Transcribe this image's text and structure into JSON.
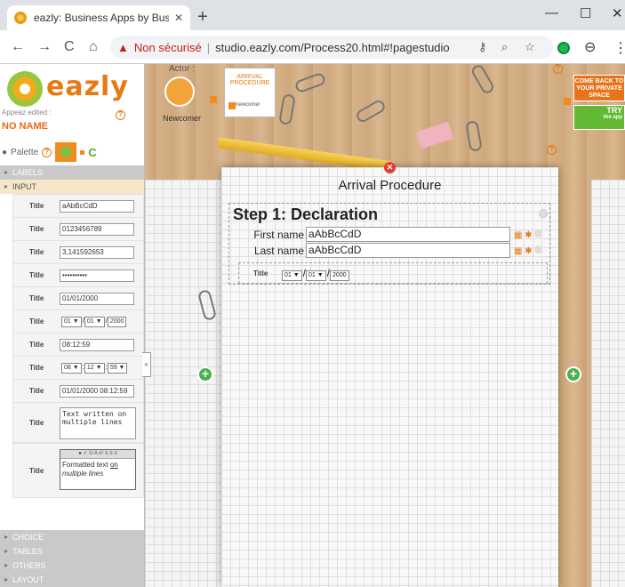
{
  "browser": {
    "tab_title": "eazly: Business Apps by Business",
    "tab_close": "✕",
    "new_tab": "+",
    "window_controls": [
      "—",
      "☐",
      "✕"
    ],
    "security_label": "Non sécurisé",
    "url": "studio.eazly.com/Process20.html#!pagestudio",
    "nav": [
      "←",
      "→",
      "C",
      "⌂"
    ]
  },
  "sidebar": {
    "logo": "eazly",
    "appeaz_label": "Appeaz edited :",
    "app_name": "NO NAME",
    "palette_label": "Palette",
    "sections_top": [
      "LABELS",
      "INPUT"
    ],
    "sections_bottom": [
      "CHOICE",
      "TABLES",
      "OTHERS",
      "LAYOUT"
    ],
    "input_rows": [
      {
        "label": "Title",
        "value": "aAbBcCdD"
      },
      {
        "label": "Title",
        "value": "0123456789"
      },
      {
        "label": "Title",
        "value": "3,141592653"
      },
      {
        "label": "Title",
        "value": "••••••••••"
      },
      {
        "label": "Title",
        "value": "01/01/2000"
      },
      {
        "label": "Title",
        "sel1": "01 ▼",
        "sel2": "01 ▼",
        "sel3": "2000"
      },
      {
        "label": "Title",
        "value": "08:12:59"
      },
      {
        "label": "Title",
        "sel1": "08 ▼",
        "sel2": "12 ▼",
        "sel3": "59 ▼"
      },
      {
        "label": "Title",
        "value": "01/01/2000 08:12:59"
      },
      {
        "label": "Title",
        "value": "Text written on multiple lines"
      },
      {
        "label": "Title",
        "value_a": "Formatted",
        "value_b": "text",
        "value_c": "on",
        "value_d": "multiple lines"
      }
    ]
  },
  "topbar": {
    "actor_label": "Actor :",
    "actor_name": "Newcomer",
    "process_card_title": "ARRIVAL PROCEDURE",
    "process_card_actor": "newcomer",
    "back_button": "COME BACK TO YOUR PRIVATE SPACE",
    "try_button": "TRY",
    "try_sub": "the app"
  },
  "canvas": {
    "title": "Arrival Procedure",
    "step_title": "Step 1: Declaration",
    "fields": [
      {
        "label": "First name",
        "value": "aAbBcCdD"
      },
      {
        "label": "Last name",
        "value": "aAbBcCdD"
      }
    ],
    "date_row": {
      "label": "Title",
      "sel1": "01 ▼",
      "sel2": "01 ▼",
      "sel3": "2000"
    }
  },
  "colors": {
    "accent": "#e87a16",
    "green": "#63b934",
    "red": "#e53935"
  }
}
